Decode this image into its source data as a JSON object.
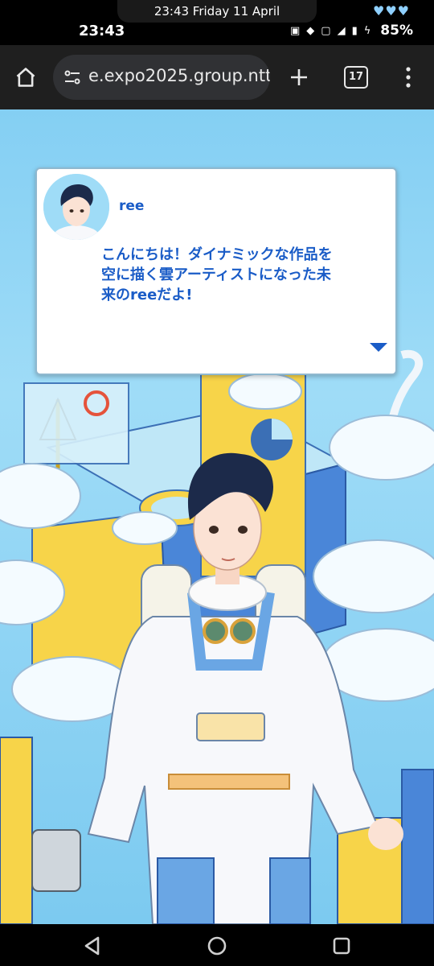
{
  "status_bar": {
    "notification": "23:43 Friday 11 April",
    "time": "23:43",
    "battery": "85%",
    "hearts": "♥♥♥"
  },
  "browser": {
    "url": "e.expo2025.group.ntt",
    "tab_count": "17"
  },
  "dialog": {
    "speaker": "ree",
    "message": "こんにちは！ダイナミックな作品を空に描く雲アーティストになった未来のreeだよ!"
  },
  "icons": {
    "home": "home-icon",
    "site_info": "tune-icon",
    "new_tab": "plus-icon",
    "menu": "more-vert-icon",
    "next": "triangle-down-icon",
    "back": "back-triangle-icon",
    "home_nav": "home-circle-icon",
    "recents": "recents-square-icon"
  },
  "colors": {
    "accent_text": "#1a5cc7",
    "sky": "#84cff3"
  }
}
